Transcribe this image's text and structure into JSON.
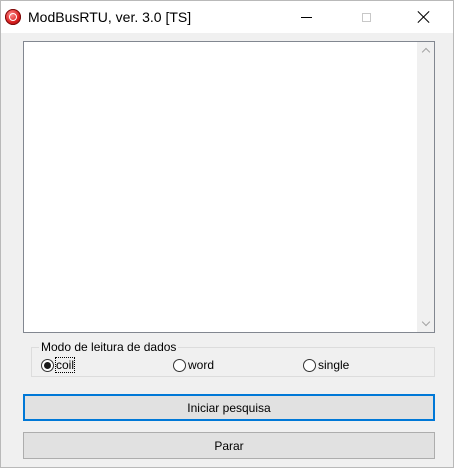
{
  "window": {
    "title": "ModBusRTU, ver. 3.0 [TS]",
    "icon": "app-logo-icon",
    "controls": {
      "minimize_icon": "minimize-icon",
      "maximize_icon": "maximize-icon",
      "close_icon": "close-icon"
    }
  },
  "log": {
    "content": "",
    "scrollbar": {
      "up_icon": "chevron-up-icon",
      "down_icon": "chevron-down-icon"
    }
  },
  "read_mode": {
    "legend": "Modo de leitura de dados",
    "options": [
      {
        "label": "coil",
        "checked": true
      },
      {
        "label": "word",
        "checked": false
      },
      {
        "label": "single",
        "checked": false
      }
    ]
  },
  "buttons": {
    "start_label": "Iniciar pesquisa",
    "stop_label": "Parar"
  },
  "colors": {
    "focus_border": "#0078d7",
    "button_face": "#e1e1e1",
    "window_bg": "#f0f0f0"
  }
}
